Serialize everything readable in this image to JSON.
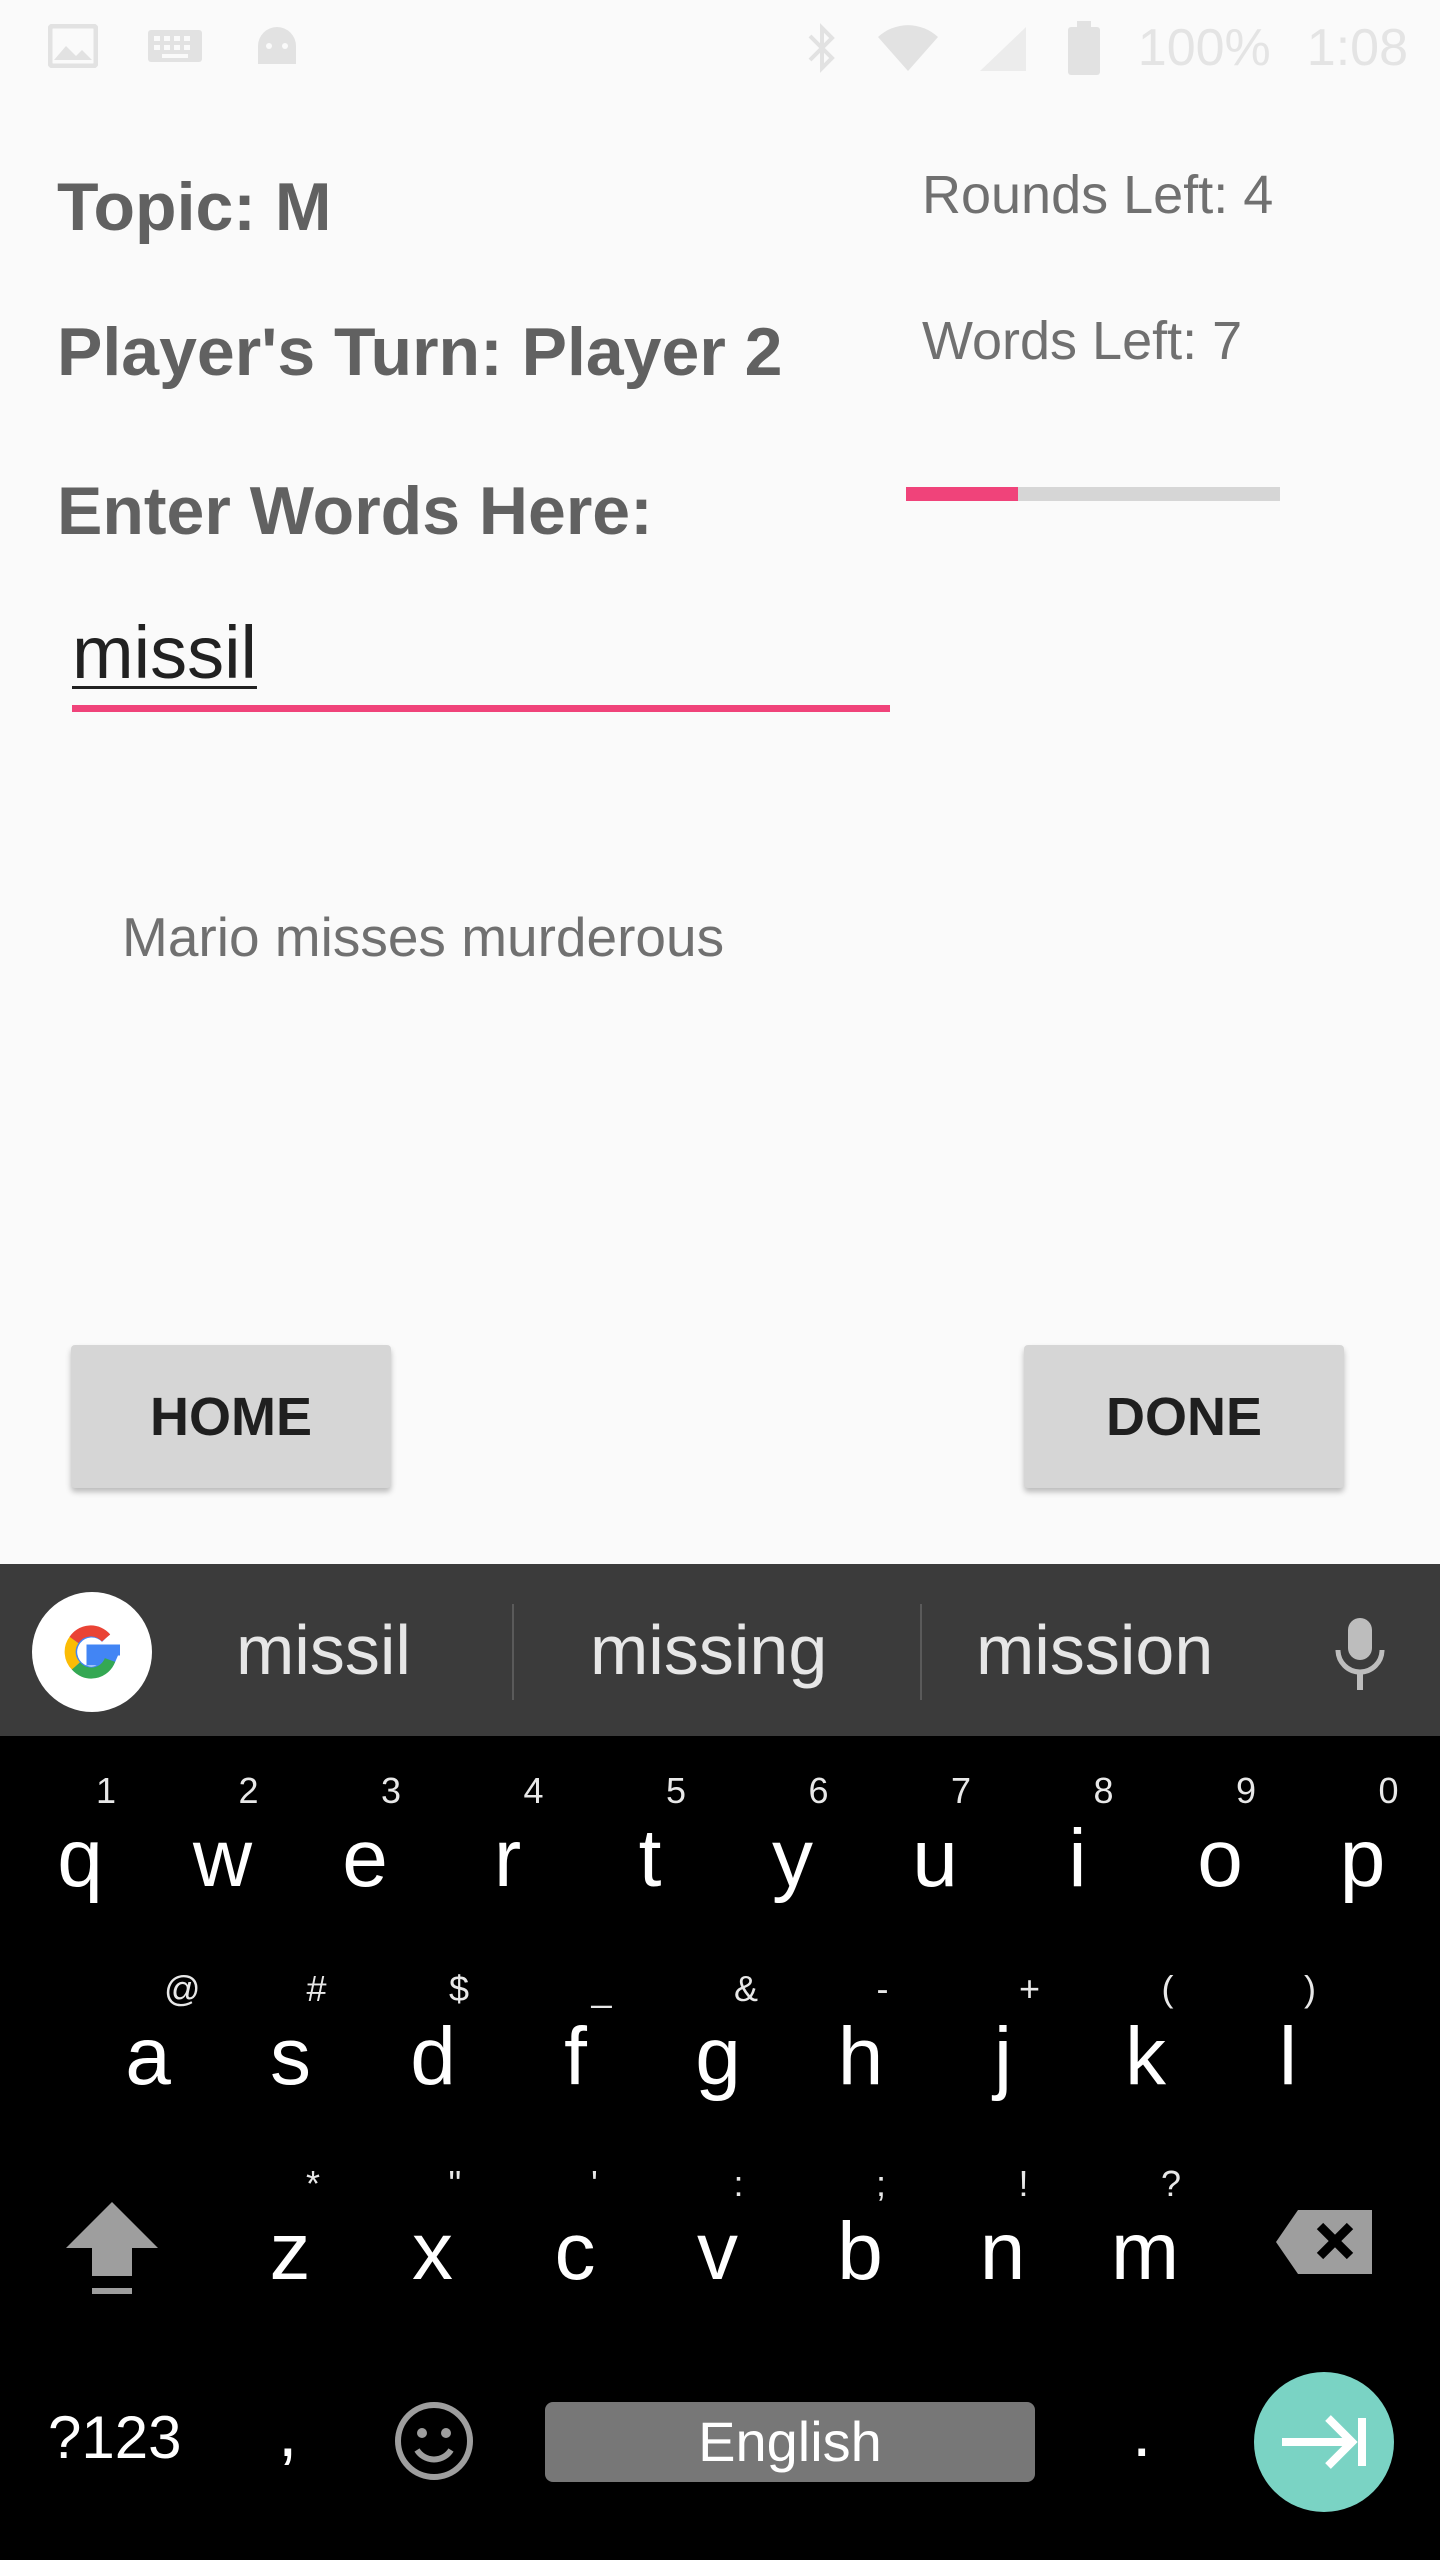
{
  "status_bar": {
    "battery_text": "100%",
    "time": "1:08",
    "icons": [
      "image-icon",
      "keyboard-icon",
      "android-icon",
      "bluetooth-icon",
      "wifi-icon",
      "signal-icon",
      "battery-icon"
    ]
  },
  "game": {
    "topic": "Topic: M",
    "turn": "Player's Turn: Player 2",
    "enter_label": "Enter Words Here:",
    "rounds_left": "Rounds Left: 4",
    "words_left": "Words Left: 7",
    "timer_progress": 0.3,
    "input_value": "missil",
    "entered_words": "Mario misses murderous",
    "home_label": "HOME",
    "done_label": "DONE"
  },
  "colors": {
    "accent": "#f0437a",
    "enter_key": "#7ad3c4"
  },
  "keyboard": {
    "suggestions": [
      "missil",
      "missing",
      "mission"
    ],
    "row1": [
      {
        "k": "q",
        "h": "1"
      },
      {
        "k": "w",
        "h": "2"
      },
      {
        "k": "e",
        "h": "3"
      },
      {
        "k": "r",
        "h": "4"
      },
      {
        "k": "t",
        "h": "5"
      },
      {
        "k": "y",
        "h": "6"
      },
      {
        "k": "u",
        "h": "7"
      },
      {
        "k": "i",
        "h": "8"
      },
      {
        "k": "o",
        "h": "9"
      },
      {
        "k": "p",
        "h": "0"
      }
    ],
    "row2": [
      {
        "k": "a",
        "h": "@"
      },
      {
        "k": "s",
        "h": "#"
      },
      {
        "k": "d",
        "h": "$"
      },
      {
        "k": "f",
        "h": "_"
      },
      {
        "k": "g",
        "h": "&"
      },
      {
        "k": "h",
        "h": "-"
      },
      {
        "k": "j",
        "h": "+"
      },
      {
        "k": "k",
        "h": "("
      },
      {
        "k": "l",
        "h": ")"
      }
    ],
    "row3": [
      {
        "k": "z",
        "h": "*"
      },
      {
        "k": "x",
        "h": "\""
      },
      {
        "k": "c",
        "h": "'"
      },
      {
        "k": "v",
        "h": ":"
      },
      {
        "k": "b",
        "h": ";"
      },
      {
        "k": "n",
        "h": "!"
      },
      {
        "k": "m",
        "h": "?"
      }
    ],
    "symbols_key": "?123",
    "comma_key": ",",
    "space_label": "English",
    "period_key": "."
  }
}
